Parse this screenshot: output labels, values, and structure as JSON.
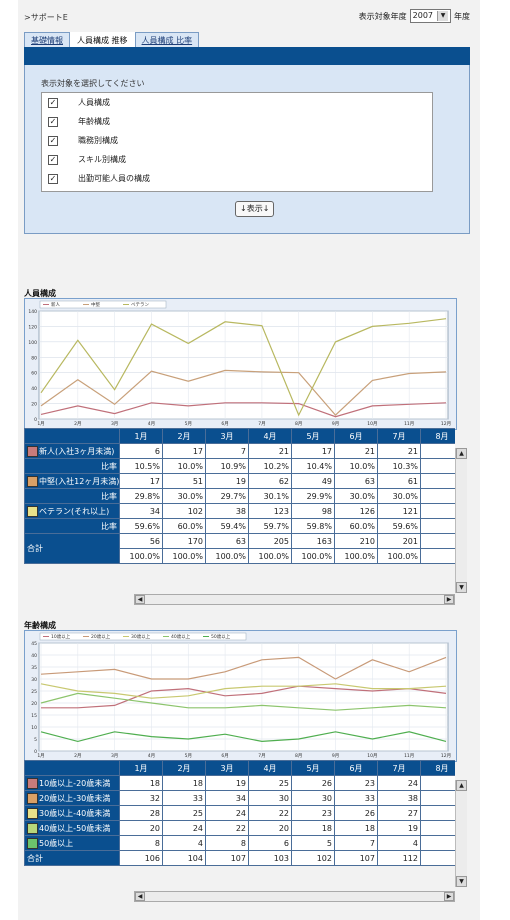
{
  "breadcrumb": ">サポートE",
  "year_selector": {
    "label": "表示対象年度",
    "value": "2007",
    "suffix": "年度"
  },
  "tabs": [
    {
      "label": "基礎情報",
      "active": false
    },
    {
      "label": "人員構成 推移",
      "active": true
    },
    {
      "label": "人員構成 比率",
      "active": false
    }
  ],
  "selection": {
    "prompt": "表示対象を選択してください",
    "items": [
      {
        "label": "人員構成",
        "checked": true
      },
      {
        "label": "年齢構成",
        "checked": true
      },
      {
        "label": "職務別構成",
        "checked": true
      },
      {
        "label": "スキル別構成",
        "checked": true
      },
      {
        "label": "出勤可能人員の構成",
        "checked": true
      }
    ],
    "show_button": "↓表示↓"
  },
  "section1": {
    "title": "人員構成",
    "months": [
      "1月",
      "2月",
      "3月",
      "4月",
      "5月",
      "6月",
      "7月",
      "8月"
    ],
    "rows": [
      {
        "name": "新人(入社3ヶ月未満)",
        "color": "#c97b7b",
        "values": [
          "6",
          "17",
          "7",
          "21",
          "17",
          "21",
          "21"
        ],
        "ratio_label": "比率",
        "ratios": [
          "10.5%",
          "10.0%",
          "10.9%",
          "10.2%",
          "10.4%",
          "10.0%",
          "10.3%"
        ]
      },
      {
        "name": "中堅(入社12ヶ月未満)",
        "color": "#d9a066",
        "values": [
          "17",
          "51",
          "19",
          "62",
          "49",
          "63",
          "61"
        ],
        "ratio_label": "比率",
        "ratios": [
          "29.8%",
          "30.0%",
          "29.7%",
          "30.1%",
          "29.9%",
          "30.0%",
          "30.0%"
        ]
      },
      {
        "name": "ベテラン(それ以上)",
        "color": "#e8e28a",
        "values": [
          "34",
          "102",
          "38",
          "123",
          "98",
          "126",
          "121"
        ],
        "ratio_label": "比率",
        "ratios": [
          "59.6%",
          "60.0%",
          "59.4%",
          "59.7%",
          "59.8%",
          "60.0%",
          "59.6%"
        ]
      }
    ],
    "total_label": "合計",
    "totals": [
      "56",
      "170",
      "63",
      "205",
      "163",
      "210",
      "201"
    ],
    "total_ratios": [
      "100.0%",
      "100.0%",
      "100.0%",
      "100.0%",
      "100.0%",
      "100.0%",
      "100.0%"
    ]
  },
  "section2": {
    "title": "年齢構成",
    "months": [
      "1月",
      "2月",
      "3月",
      "4月",
      "5月",
      "6月",
      "7月",
      "8月"
    ],
    "rows": [
      {
        "name": "10歳以上-20歳未満",
        "color": "#c97b7b",
        "values": [
          "18",
          "18",
          "19",
          "25",
          "26",
          "23",
          "24"
        ]
      },
      {
        "name": "20歳以上-30歳未満",
        "color": "#d9a066",
        "values": [
          "32",
          "33",
          "34",
          "30",
          "30",
          "33",
          "38"
        ]
      },
      {
        "name": "30歳以上-40歳未満",
        "color": "#e8e28a",
        "values": [
          "28",
          "25",
          "24",
          "22",
          "23",
          "26",
          "27"
        ]
      },
      {
        "name": "40歳以上-50歳未満",
        "color": "#b7d77a",
        "values": [
          "20",
          "24",
          "22",
          "20",
          "18",
          "18",
          "19"
        ]
      },
      {
        "name": "50歳以上",
        "color": "#6cc46c",
        "values": [
          "8",
          "4",
          "8",
          "6",
          "5",
          "7",
          "4"
        ]
      }
    ],
    "total_label": "合計",
    "totals": [
      "106",
      "104",
      "107",
      "103",
      "102",
      "107",
      "112"
    ]
  },
  "chart_data": [
    {
      "type": "line",
      "title": "人員構成",
      "x": [
        "1月",
        "2月",
        "3月",
        "4月",
        "5月",
        "6月",
        "7月",
        "8月",
        "9月",
        "10月",
        "11月",
        "12月"
      ],
      "ylim": [
        0,
        140
      ],
      "yticks": [
        0,
        20,
        40,
        60,
        80,
        100,
        120,
        140
      ],
      "grid": true,
      "legend": "top-left",
      "series": [
        {
          "name": "新人",
          "color": "#c0707a",
          "values": [
            6,
            17,
            7,
            21,
            17,
            21,
            21,
            20,
            3,
            17,
            19,
            21
          ]
        },
        {
          "name": "中堅",
          "color": "#c8a07a",
          "values": [
            17,
            51,
            19,
            62,
            49,
            63,
            61,
            60,
            5,
            50,
            59,
            61
          ]
        },
        {
          "name": "ベテラン",
          "color": "#b8b860",
          "values": [
            34,
            102,
            38,
            123,
            98,
            126,
            121,
            5,
            100,
            120,
            124,
            130
          ]
        }
      ]
    },
    {
      "type": "line",
      "title": "年齢構成",
      "x": [
        "1月",
        "2月",
        "3月",
        "4月",
        "5月",
        "6月",
        "7月",
        "8月",
        "9月",
        "10月",
        "11月",
        "12月"
      ],
      "ylim": [
        0,
        45
      ],
      "yticks": [
        0,
        5,
        10,
        15,
        20,
        25,
        30,
        35,
        40,
        45
      ],
      "grid": true,
      "legend": "top-left",
      "legend_labels": [
        "10歳以上",
        "20歳以上",
        "30歳以上",
        "40歳以上",
        "50歳以上"
      ],
      "series": [
        {
          "name": "10歳以上-20歳未満",
          "color": "#c0707a",
          "values": [
            18,
            18,
            19,
            25,
            26,
            23,
            24,
            27,
            26,
            25,
            26,
            24
          ]
        },
        {
          "name": "20歳以上-30歳未満",
          "color": "#c89a78",
          "values": [
            32,
            33,
            34,
            30,
            30,
            33,
            38,
            39,
            30,
            38,
            33,
            39
          ]
        },
        {
          "name": "30歳以上-40歳未満",
          "color": "#c8c870",
          "values": [
            28,
            25,
            24,
            22,
            23,
            26,
            27,
            27,
            28,
            26,
            26,
            27
          ]
        },
        {
          "name": "40歳以上-50歳未満",
          "color": "#8cc46c",
          "values": [
            20,
            24,
            22,
            20,
            18,
            18,
            19,
            18,
            17,
            18,
            19,
            18
          ]
        },
        {
          "name": "50歳以上",
          "color": "#4fae4f",
          "values": [
            8,
            4,
            8,
            6,
            5,
            7,
            4,
            5,
            8,
            5,
            8,
            4
          ]
        }
      ]
    }
  ]
}
